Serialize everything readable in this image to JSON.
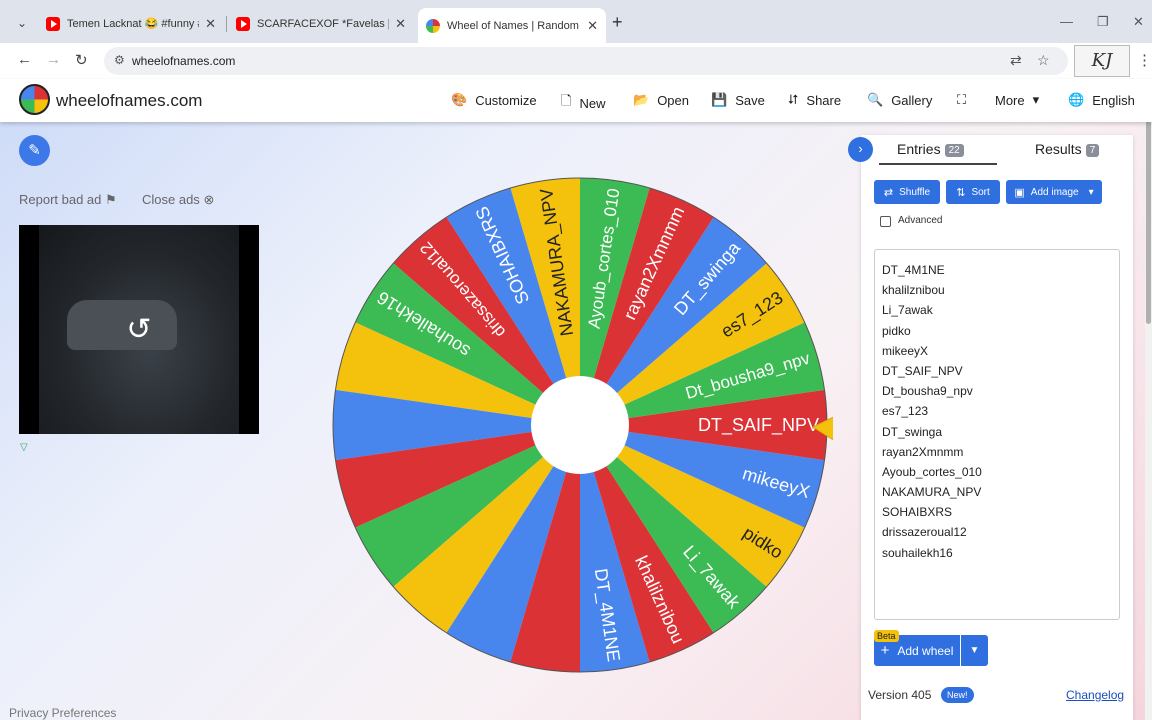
{
  "browser": {
    "tabs": [
      {
        "title": "Temen Lacknat 😂 #funny #sho",
        "favicon": "youtube-icon",
        "active": false
      },
      {
        "title": "SCARFACEXOF *Favelas [BOBO",
        "favicon": "youtube-icon",
        "active": false
      },
      {
        "title": "Wheel of Names | Random nam",
        "favicon": "wheel-icon",
        "active": true
      }
    ],
    "url": "wheelofnames.com"
  },
  "site": {
    "name": "wheelofnames.com",
    "menu": [
      {
        "icon": "palette-icon",
        "glyph": "🎨",
        "label": "Customize"
      },
      {
        "icon": "file-icon",
        "glyph": "🗋",
        "label": "New"
      },
      {
        "icon": "folder-open-icon",
        "glyph": "📂",
        "label": "Open"
      },
      {
        "icon": "save-icon",
        "glyph": "💾",
        "label": "Save"
      },
      {
        "icon": "share-icon",
        "glyph": "⮃",
        "label": "Share"
      },
      {
        "icon": "search-icon",
        "glyph": "🔍",
        "label": "Gallery"
      },
      {
        "icon": "fullscreen-icon",
        "glyph": "⛶",
        "label": ""
      },
      {
        "icon": "chevron-down-icon",
        "glyph": "",
        "label": "More"
      },
      {
        "icon": "globe-icon",
        "glyph": "🌐",
        "label": "English"
      }
    ]
  },
  "left": {
    "report_ad": "Report bad ad",
    "close_ads": "Close ads",
    "privacy": "Privacy Preferences"
  },
  "wheel": {
    "colors": [
      "#4885ed",
      "#db3236",
      "#3cba54",
      "#f4c20d"
    ],
    "pointer_color": "#f4c20d",
    "slices": [
      "DT_4M1NE",
      "khalilznibou",
      "Li_7awak",
      "pidko",
      "mikeeyX",
      "DT_SAIF_NPV",
      "Dt_bousha9_npv",
      "es7_123",
      "DT_swinga",
      "rayan2Xmnmm",
      "Ayoub_cortes_010",
      "NAKAMURA_NPV",
      "SOHAIBXRS",
      "drissazeroual12",
      "souhailekh16"
    ],
    "unlabeled_slices": 7
  },
  "panel": {
    "tab_entries": "Entries",
    "entries_count": "22",
    "tab_results": "Results",
    "results_count": "7",
    "shuffle": "Shuffle",
    "sort": "Sort",
    "add_image": "Add image",
    "advanced": "Advanced",
    "entries": [
      "DT_4M1NE",
      "khalilznibou",
      "Li_7awak",
      "pidko",
      "mikeeyX",
      "DT_SAIF_NPV",
      "Dt_bousha9_npv",
      "es7_123",
      "DT_swinga",
      "rayan2Xmnmm",
      "Ayoub_cortes_010",
      "NAKAMURA_NPV",
      "SOHAIBXRS",
      "drissazeroual12",
      "souhailekh16"
    ],
    "beta": "Beta",
    "add_wheel": "Add wheel",
    "version": "Version 405",
    "new_badge": "New!",
    "changelog": "Changelog"
  }
}
